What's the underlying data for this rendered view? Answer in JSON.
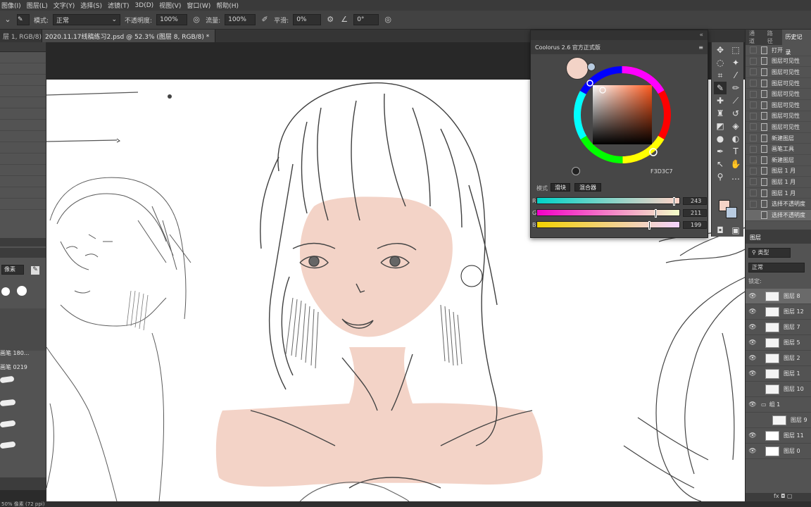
{
  "menubar": {
    "items": [
      "图像(I)",
      "图层(L)",
      "文字(Y)",
      "选择(S)",
      "滤镜(T)",
      "3D(D)",
      "视图(V)",
      "窗口(W)",
      "帮助(H)"
    ]
  },
  "options": {
    "mode_label": "模式:",
    "mode_value": "正常",
    "opacity_label": "不透明度:",
    "opacity_value": "100%",
    "flow_label": "流量:",
    "flow_value": "100%",
    "smoothing_label": "平滑:",
    "smoothing_value": "0%",
    "angle_value": "0°"
  },
  "tabs": [
    {
      "label": "层 1, RGB/8) *",
      "active": false
    },
    {
      "label": "2020.11.17线稿练习2.psd @ 52.3% (图层 8, RGB/8) *",
      "active": true
    }
  ],
  "left_panel": {
    "brush_label": "像素",
    "brush_items": [
      "画笔 180...",
      "画笔 0219"
    ]
  },
  "colorus": {
    "title": "Coolorus 2.6 官方正式版",
    "swatch_color": "#F3D3C7",
    "hex_value": "F3D3C7",
    "mode_label": "模式",
    "btn_block": "滑块",
    "btn_mixer": "混合器",
    "sliders": [
      {
        "label": "R",
        "value": "243",
        "level": 0.953,
        "gradient": "linear-gradient(90deg,#00d3c7,#f3d3c7 95%,#ffd3c7)"
      },
      {
        "label": "G",
        "value": "211",
        "level": 0.827,
        "gradient": "linear-gradient(90deg,#f300c7,#f3d3c7 83%,#f3ffc7)"
      },
      {
        "label": "B",
        "value": "199",
        "level": 0.78,
        "gradient": "linear-gradient(90deg,#f3d300,#f3d3c7 78%,#f3d3ff)"
      }
    ]
  },
  "history": {
    "tabs": [
      "通道",
      "路径",
      "历史记录"
    ],
    "items": [
      "打开",
      "图层可见性",
      "图层可见性",
      "图层可见性",
      "图层可见性",
      "图层可见性",
      "图层可见性",
      "图层可见性",
      "新建图层",
      "画笔工具",
      "新建图层",
      "图层 1 月",
      "图层 1 月",
      "图层 1 月",
      "选择不透明度",
      "选择不透明度"
    ]
  },
  "layers": {
    "tab_label": "图层",
    "filter_label": "类型",
    "blend_mode": "正常",
    "lock_label": "锁定:",
    "rows": [
      {
        "name": "图层 8",
        "visible": true,
        "selected": true
      },
      {
        "name": "图层 12",
        "visible": true,
        "selected": false
      },
      {
        "name": "图层 7",
        "visible": true,
        "selected": false
      },
      {
        "name": "图层 5",
        "visible": true,
        "selected": false
      },
      {
        "name": "图层 2",
        "visible": true,
        "selected": false
      },
      {
        "name": "图层 1",
        "visible": true,
        "selected": false
      },
      {
        "name": "图层 10",
        "visible": false,
        "selected": false
      },
      {
        "name": "组 1",
        "visible": true,
        "selected": false
      },
      {
        "name": "图层 9",
        "visible": false,
        "selected": false
      },
      {
        "name": "图层 11",
        "visible": true,
        "selected": false
      },
      {
        "name": "图层 0",
        "visible": true,
        "selected": false
      }
    ]
  },
  "status": {
    "text": "50% 像素 (72 ppi)"
  },
  "colors": {
    "skin": "#f3d3c7",
    "foreground": "#f3d3c7",
    "background": "#b8cbe0"
  }
}
